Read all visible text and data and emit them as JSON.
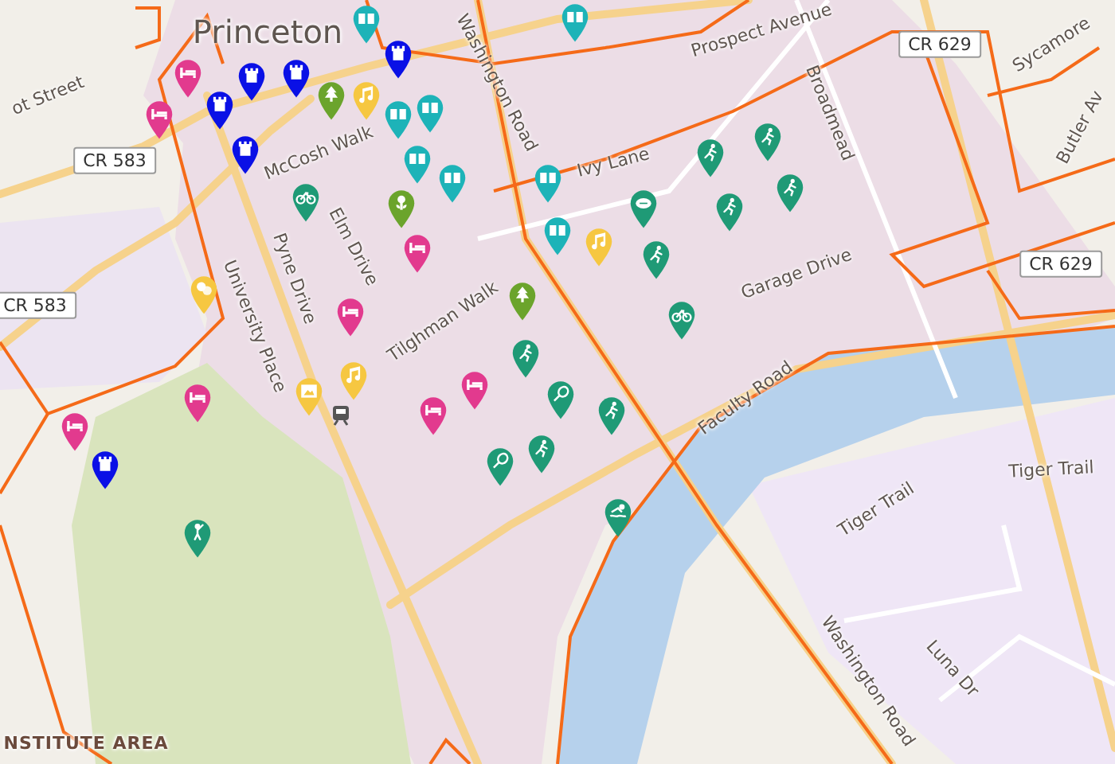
{
  "map": {
    "labels": [
      {
        "text": "Princeton",
        "kind": "city"
      },
      {
        "text": "ot Street",
        "kind": "street"
      },
      {
        "text": "McCosh Walk",
        "kind": "street"
      },
      {
        "text": "Washington Road",
        "kind": "street"
      },
      {
        "text": "Elm Drive",
        "kind": "street"
      },
      {
        "text": "Pyne Drive",
        "kind": "street"
      },
      {
        "text": "University Place",
        "kind": "street"
      },
      {
        "text": "Tilghman Walk",
        "kind": "street"
      },
      {
        "text": "Ivy Lane",
        "kind": "street"
      },
      {
        "text": "Prospect Avenue",
        "kind": "street"
      },
      {
        "text": "Broadmead",
        "kind": "street"
      },
      {
        "text": "Sycamore",
        "kind": "street"
      },
      {
        "text": "Butler Av",
        "kind": "street"
      },
      {
        "text": "Garage Drive",
        "kind": "street"
      },
      {
        "text": "Faculty Road",
        "kind": "street"
      },
      {
        "text": "Tiger Trail",
        "kind": "street"
      },
      {
        "text": "Tiger Trail",
        "kind": "street"
      },
      {
        "text": "Luna Dr",
        "kind": "street"
      },
      {
        "text": "Washington Road",
        "kind": "street"
      },
      {
        "text": "NSTITUTE AREA",
        "kind": "area"
      }
    ],
    "shields": [
      "CR 583",
      "CR 583",
      "CR 629",
      "CR 629"
    ],
    "markers": [
      {
        "kind": "bed",
        "color": "#e23a8e"
      },
      {
        "kind": "bed",
        "color": "#e23a8e"
      },
      {
        "kind": "bed",
        "color": "#e23a8e"
      },
      {
        "kind": "bed",
        "color": "#e23a8e"
      },
      {
        "kind": "bed",
        "color": "#e23a8e"
      },
      {
        "kind": "bed",
        "color": "#e23a8e"
      },
      {
        "kind": "bed",
        "color": "#e23a8e"
      },
      {
        "kind": "bed",
        "color": "#e23a8e"
      },
      {
        "kind": "castle",
        "color": "#0a10e6"
      },
      {
        "kind": "castle",
        "color": "#0a10e6"
      },
      {
        "kind": "castle",
        "color": "#0a10e6"
      },
      {
        "kind": "castle",
        "color": "#0a10e6"
      },
      {
        "kind": "castle",
        "color": "#0a10e6"
      },
      {
        "kind": "castle",
        "color": "#0a10e6"
      },
      {
        "kind": "book",
        "color": "#1db3b8"
      },
      {
        "kind": "book",
        "color": "#1db3b8"
      },
      {
        "kind": "book",
        "color": "#1db3b8"
      },
      {
        "kind": "book",
        "color": "#1db3b8"
      },
      {
        "kind": "book",
        "color": "#1db3b8"
      },
      {
        "kind": "book",
        "color": "#1db3b8"
      },
      {
        "kind": "book",
        "color": "#1db3b8"
      },
      {
        "kind": "book",
        "color": "#1db3b8"
      },
      {
        "kind": "tree",
        "color": "#6ba42c"
      },
      {
        "kind": "tree",
        "color": "#6ba42c"
      },
      {
        "kind": "flower",
        "color": "#6ba42c"
      },
      {
        "kind": "music",
        "color": "#f6c741"
      },
      {
        "kind": "music",
        "color": "#f6c741"
      },
      {
        "kind": "music",
        "color": "#f6c741"
      },
      {
        "kind": "theatre",
        "color": "#f6c741"
      },
      {
        "kind": "gallery",
        "color": "#f6c741"
      },
      {
        "kind": "bike",
        "color": "#1f9a76"
      },
      {
        "kind": "runner",
        "color": "#1f9a76"
      },
      {
        "kind": "runner",
        "color": "#1f9a76"
      },
      {
        "kind": "runner",
        "color": "#1f9a76"
      },
      {
        "kind": "runner",
        "color": "#1f9a76"
      },
      {
        "kind": "runner",
        "color": "#1f9a76"
      },
      {
        "kind": "runner",
        "color": "#1f9a76"
      },
      {
        "kind": "runner",
        "color": "#1f9a76"
      },
      {
        "kind": "runner",
        "color": "#1f9a76"
      },
      {
        "kind": "tennis",
        "color": "#1f9a76"
      },
      {
        "kind": "tennis",
        "color": "#1f9a76"
      },
      {
        "kind": "ball",
        "color": "#1f9a76"
      },
      {
        "kind": "bike",
        "color": "#1f9a76"
      },
      {
        "kind": "golf",
        "color": "#1f9a76"
      },
      {
        "kind": "swim",
        "color": "#1f9a76"
      }
    ]
  }
}
